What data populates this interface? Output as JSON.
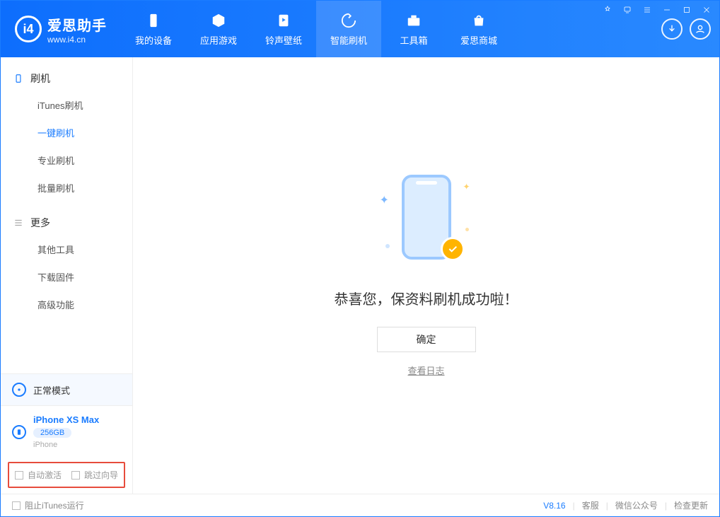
{
  "app": {
    "name": "爱思助手",
    "url": "www.i4.cn"
  },
  "nav": {
    "items": [
      {
        "label": "我的设备"
      },
      {
        "label": "应用游戏"
      },
      {
        "label": "铃声壁纸"
      },
      {
        "label": "智能刷机"
      },
      {
        "label": "工具箱"
      },
      {
        "label": "爱思商城"
      }
    ]
  },
  "sidebar": {
    "section1": {
      "title": "刷机",
      "items": [
        {
          "label": "iTunes刷机"
        },
        {
          "label": "一键刷机"
        },
        {
          "label": "专业刷机"
        },
        {
          "label": "批量刷机"
        }
      ]
    },
    "section2": {
      "title": "更多",
      "items": [
        {
          "label": "其他工具"
        },
        {
          "label": "下载固件"
        },
        {
          "label": "高级功能"
        }
      ]
    }
  },
  "device": {
    "mode": "正常模式",
    "name": "iPhone XS Max",
    "capacity": "256GB",
    "type": "iPhone"
  },
  "options": {
    "auto_activate": "自动激活",
    "skip_guide": "跳过向导"
  },
  "main": {
    "success": "恭喜您，保资料刷机成功啦！",
    "ok": "确定",
    "view_log": "查看日志"
  },
  "footer": {
    "block_itunes": "阻止iTunes运行",
    "version": "V8.16",
    "support": "客服",
    "wechat": "微信公众号",
    "update": "检查更新"
  }
}
